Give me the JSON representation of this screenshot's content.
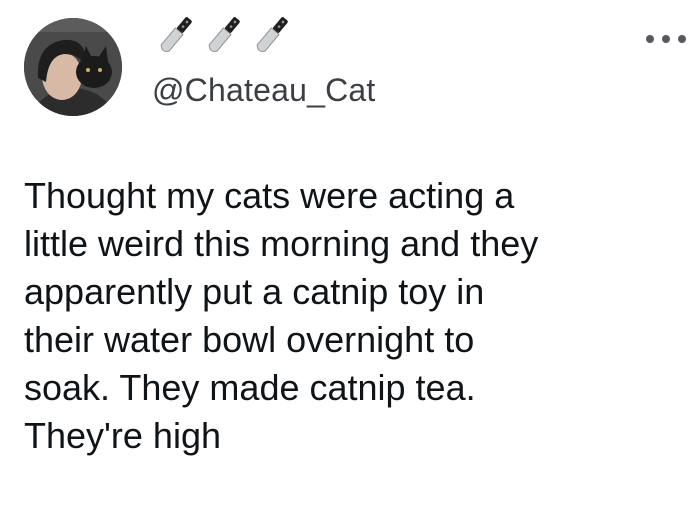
{
  "tweet": {
    "display_name_icons": [
      "kitchen-knife-icon",
      "kitchen-knife-icon",
      "kitchen-knife-icon"
    ],
    "handle": "@Chateau_Cat",
    "more_icon": "more-options-icon",
    "text_lines": [
      "Thought my cats were acting a",
      "little weird this morning and they",
      "apparently put a catnip toy in",
      "their water bowl overnight to",
      "soak. They made catnip tea.",
      "They're high"
    ]
  },
  "colors": {
    "text": "#0f1419",
    "handle": "#3b3f44",
    "icon": "#55595e"
  }
}
